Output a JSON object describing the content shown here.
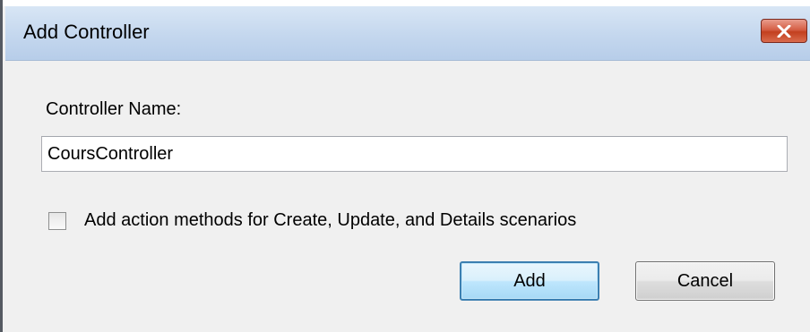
{
  "window": {
    "title": "Add Controller",
    "close_icon": "close-x-icon"
  },
  "form": {
    "controller_name_label": "Controller Name:",
    "controller_name_value": "CoursController",
    "add_action_methods_label": "Add action methods for Create, Update, and Details scenarios",
    "add_action_methods_checked": false
  },
  "buttons": {
    "add_label": "Add",
    "cancel_label": "Cancel"
  },
  "colors": {
    "titlebar": "#c4d7ee",
    "close_button": "#c2401f",
    "default_button_border": "#3c7fb1",
    "dialog_background": "#f0f0f0"
  }
}
